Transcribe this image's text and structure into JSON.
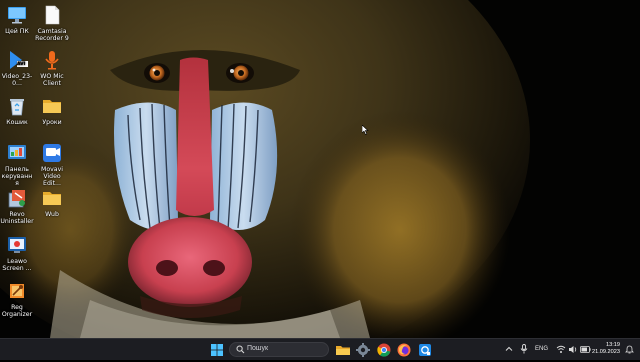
{
  "desktop": {
    "icons": [
      {
        "label": "Цей ПК",
        "icon": "monitor-icon"
      },
      {
        "label": "Camtasia Recorder 9",
        "icon": "file-icon"
      },
      {
        "label": "Video_23-0...",
        "icon": "avi-file-icon"
      },
      {
        "label": "WO Mic Client",
        "icon": "microphone-icon"
      },
      {
        "label": "Кошик",
        "icon": "recycle-bin-icon"
      },
      {
        "label": "Уроки",
        "icon": "folder-icon"
      },
      {
        "label": "Панель керування",
        "icon": "control-panel-icon"
      },
      {
        "label": "Movavi Video Edit...",
        "icon": "movavi-icon"
      },
      {
        "label": "Revo Uninstaller",
        "icon": "revo-uninstaller-icon"
      },
      {
        "label": "Wub",
        "icon": "folder-icon"
      },
      {
        "label": "Leawo Screen ...",
        "icon": "leawo-icon"
      },
      {
        "label": "Reg Organizer",
        "icon": "reg-organizer-icon"
      }
    ],
    "avi_badge": "AVI"
  },
  "taskbar": {
    "search_placeholder": "Пошук",
    "pinned": [
      {
        "name": "start-icon"
      },
      {
        "name": "file-explorer-icon"
      },
      {
        "name": "settings-icon"
      },
      {
        "name": "chrome-icon"
      },
      {
        "name": "firefox-icon"
      },
      {
        "name": "app-icon"
      }
    ],
    "tray": {
      "language": "ENG",
      "time": "13:19",
      "date": "21.09.2023"
    }
  },
  "colors": {
    "taskbar_bg": "#1c1d22",
    "folder_yellow": "#f3c244",
    "accent_blue": "#1e88e5"
  }
}
